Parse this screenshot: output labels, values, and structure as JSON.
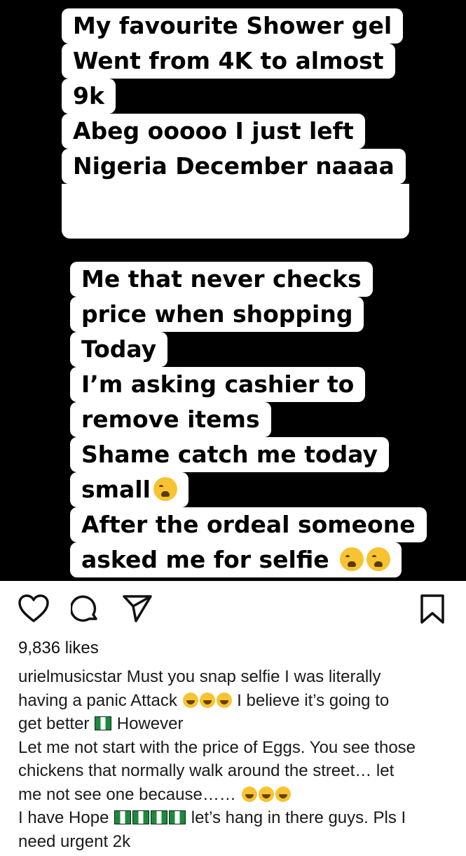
{
  "story": {
    "block1": [
      "My favourite Shower gel",
      "Went from 4K to almost",
      "9k",
      "Abeg ooooo I just left",
      "Nigeria December naaaa"
    ],
    "block2": [
      "Me that never checks",
      "price when shopping",
      "Today",
      "I’m asking cashier to",
      "remove items",
      "Shame catch me today",
      "small",
      "After the ordeal someone",
      "asked me for selfie"
    ]
  },
  "post": {
    "likes": "9,836 likes",
    "username": "urielmusicstar",
    "caption_lines": [
      "Must you snap selfie I was literally",
      "having a panic Attack",
      "I believe it’s going to",
      "get better",
      "However",
      "Let me not start with the price of Eggs. You see those",
      "chickens that normally walk around the street…  let",
      "me not see one because……",
      "I have Hope",
      "let’s hang in there guys. Pls I",
      "need urgent 2k"
    ]
  },
  "icons": {
    "heart": "heart-icon",
    "comment": "comment-icon",
    "share": "paper-plane-icon",
    "bookmark": "bookmark-icon"
  },
  "colors": {
    "story_bg": "#000000",
    "text": "#1a1a1a"
  }
}
